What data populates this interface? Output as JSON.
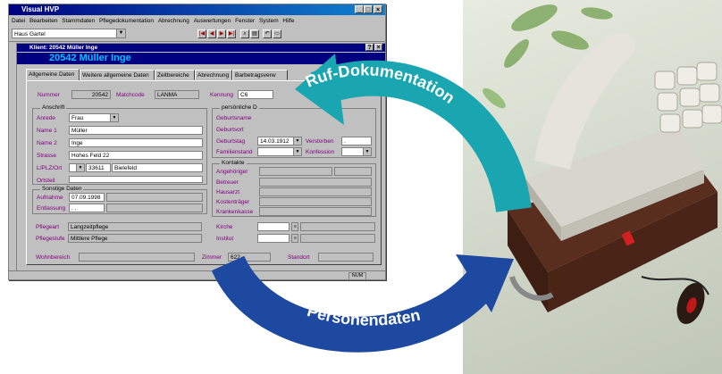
{
  "window": {
    "title": "Visual HVP",
    "menu": [
      "Datei",
      "Bearbeiten",
      "Stammdaten",
      "Pflegedokumentation",
      "Abrechnung",
      "Auswertungen",
      "Fenster",
      "System",
      "Hilfe"
    ],
    "home_combo": "Haus Gartel"
  },
  "client_window": {
    "title": "Klient: 20542 Müller Inge",
    "header": "20542 Müller Inge",
    "tabs": [
      "Allgemeine Daten",
      "Weitere allgemeine Daten",
      "Zeitbereiche",
      "Abrechnung",
      "Barbetragsverw"
    ]
  },
  "form": {
    "nummer_label": "Nummer",
    "nummer": "20542",
    "matchcode_label": "Matchcode",
    "matchcode": "LANMA",
    "kennung_label": "Kennung",
    "kennung": "C6",
    "anschrift_title": "Anschrift",
    "anrede_label": "Anrede",
    "anrede": "Frau",
    "name1_label": "Name 1",
    "name1": "Müller",
    "name2_label": "Name 2",
    "name2": "Inge",
    "strasse_label": "Strasse",
    "strasse": "Hohes Feld 22",
    "plz_label": "L/PLZ/Ort",
    "plz": "33611",
    "ort": "Bielefeld",
    "ortsteil_label": "Ortsteil",
    "sonstige_title": "Sonstige Daten",
    "aufnahme_label": "Aufnahme",
    "aufnahme": "07.09.1998",
    "entlassung_label": "Entlassung",
    "entlassung": ". .",
    "pflegeart_label": "Pflegeart",
    "pflegeart": "Langzeitpflege",
    "pflegestufe_label": "Pflegestufe",
    "pflegestufe": "Mittlere Pflege",
    "persoenlich_title": "persönliche D",
    "geburtsname_label": "Geburtsname",
    "geburtsort_label": "Geburtsort",
    "geburtstag_label": "Geburtstag",
    "geburtstag": "14.03.1912",
    "verstorben_label": "Verstorben",
    "verstorben": ".",
    "familienstand_label": "Familienstand",
    "konfession_label": "Konfession",
    "kontakte_title": "Kontakte",
    "angehoeriger_label": "Angehöriger",
    "betreuer_label": "Betreuer",
    "hausarzt_label": "Hausarzt",
    "kostentraeger_label": "Kostenträger",
    "krankenkasse_label": "Krankenkasse",
    "kirche_label": "Kirche",
    "institut_label": "Institut",
    "wohnbereich_label": "Wohnbereich",
    "zimmer_label": "Zimmer",
    "zimmer": "622",
    "standort_label": "Standort"
  },
  "status": {
    "num": "NUM"
  },
  "arrows": {
    "top_text": "Ruf-Dokumentation",
    "bottom_text": "Personendaten",
    "top_color": "#1aa6b0",
    "bottom_color": "#1d4aa0"
  }
}
